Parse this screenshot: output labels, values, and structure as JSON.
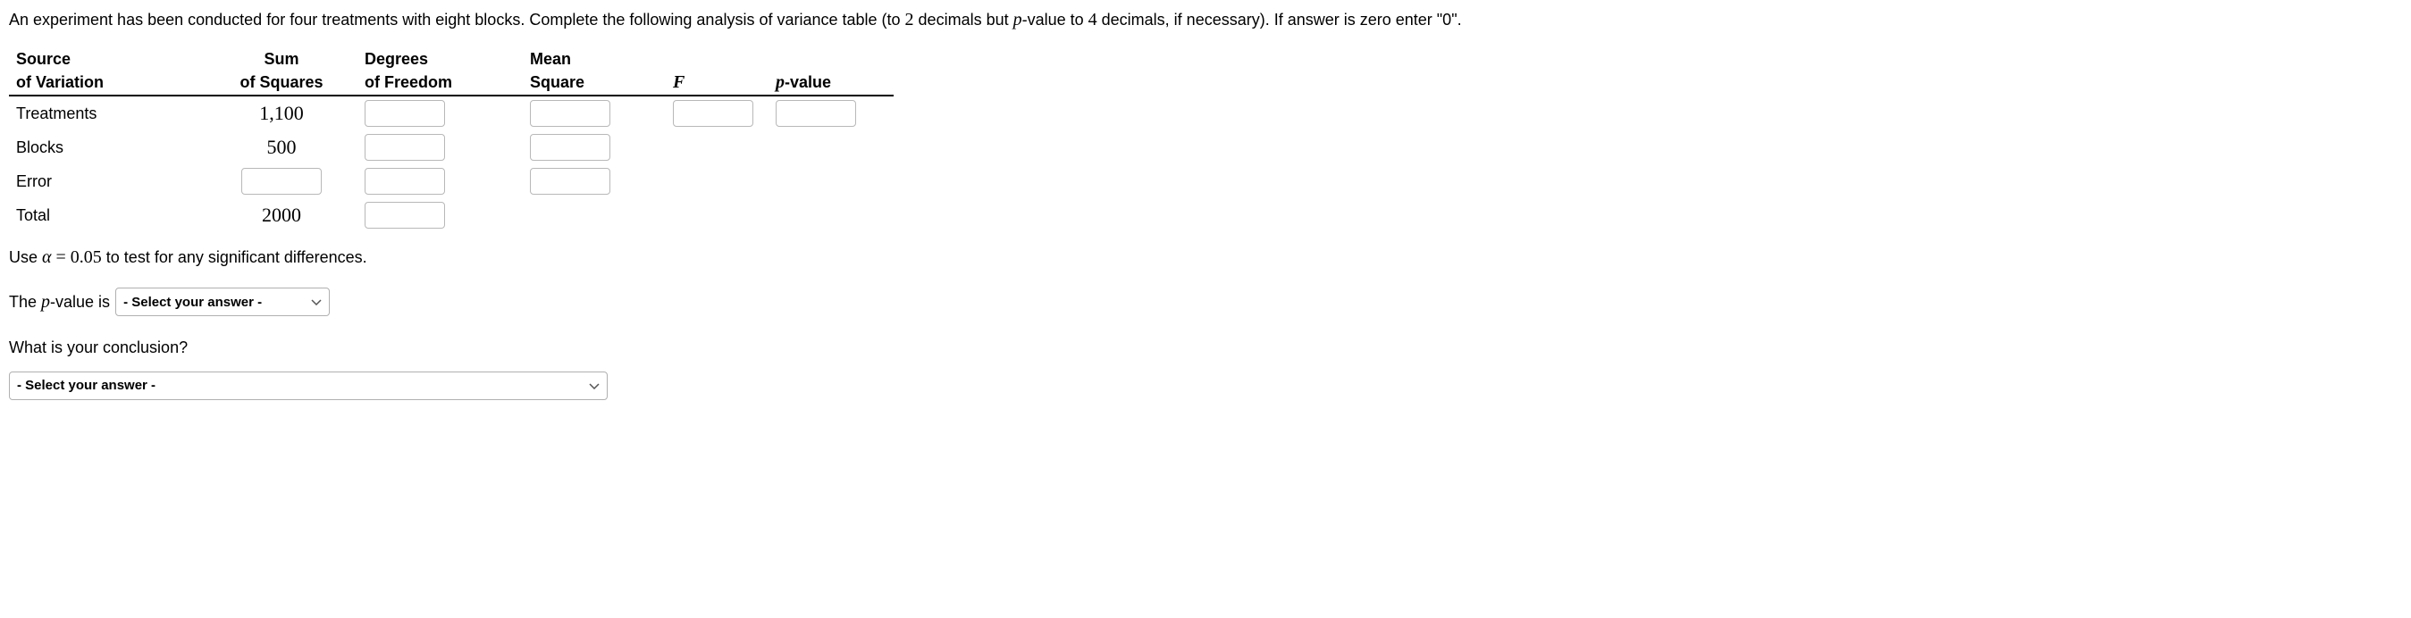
{
  "intro": {
    "pre": "An experiment has been conducted for four treatments with eight blocks. Complete the following analysis of variance table (to ",
    "two": "2",
    "mid1": " decimals but ",
    "p": "p",
    "mid2": "-value to ",
    "four": "4",
    "post": " decimals, if necessary). If answer is zero enter \"0\"."
  },
  "headers": {
    "source1": "Source",
    "source2": "of Variation",
    "sum1": "Sum",
    "sum2": "of Squares",
    "df1": "Degrees",
    "df2": "of Freedom",
    "ms1": "Mean",
    "ms2": "Square",
    "f": "F",
    "p_prefix": "p",
    "p_suffix": "-value"
  },
  "rows": {
    "treatments": {
      "label": "Treatments",
      "ss": "1,100"
    },
    "blocks": {
      "label": "Blocks",
      "ss": "500"
    },
    "error": {
      "label": "Error"
    },
    "total": {
      "label": "Total",
      "ss": "2000"
    }
  },
  "after": {
    "use_pre": "Use ",
    "alpha": "α",
    "eq": " = ",
    "alpha_val": "0.05",
    "use_post": " to test for any significant differences.",
    "pval_pre": "The ",
    "pval_p": "p",
    "pval_post": "-value is",
    "conclusion_q": "What is your conclusion?",
    "select_placeholder": "- Select your answer -"
  }
}
